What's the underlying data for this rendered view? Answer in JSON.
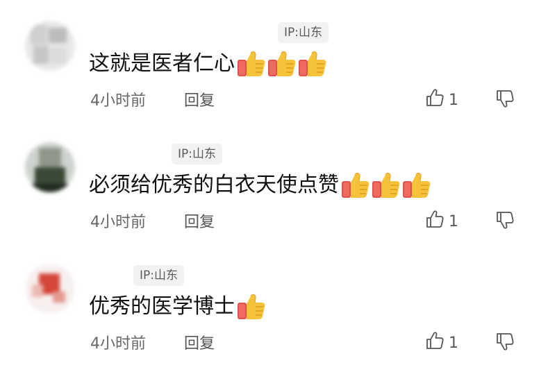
{
  "comments": [
    {
      "ip": "IP:山东",
      "text": "这就是医者仁心",
      "thumbs_count": 3,
      "time": "4小时前",
      "reply": "回复",
      "likes": "1",
      "avatar_colors": [
        "#d8d8d8",
        "#e6e6e6",
        "#c9c9c9",
        "#bdbdbd"
      ]
    },
    {
      "ip": "IP:山东",
      "text": "必须给优秀的白衣天使点赞",
      "thumbs_count": 3,
      "time": "4小时前",
      "reply": "回复",
      "likes": "1",
      "avatar_colors": [
        "#9aa39c",
        "#3b4a3a",
        "#6c7c62",
        "#2f3a2d"
      ]
    },
    {
      "ip": "IP:山东",
      "text": "优秀的医学博士",
      "thumbs_count": 1,
      "time": "4小时前",
      "reply": "回复",
      "likes": "1",
      "avatar_colors": [
        "#f3d9d6",
        "#c7392e",
        "#e38c82",
        "#f7eeee"
      ]
    }
  ],
  "icons": {
    "thumbs_up_emoji": "thumbs-up-emoji",
    "like": "thumb-up-outline-icon",
    "dislike": "thumb-down-outline-icon"
  }
}
